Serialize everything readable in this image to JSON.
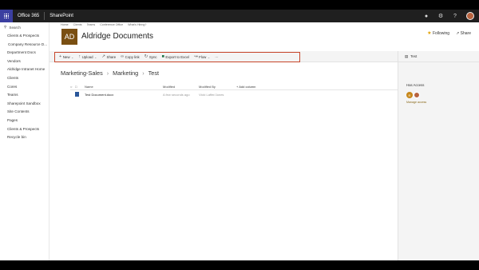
{
  "suitebar": {
    "brand": "Office 365",
    "app": "SharePoint",
    "icons": [
      "bell-icon",
      "gear-icon",
      "help-icon"
    ]
  },
  "leftnav": {
    "search_label": "Search",
    "items": [
      "Clients & Prospects",
      "Company Resource D...",
      "Department Docs",
      "Vendors",
      "Aldridge Intranet Home",
      "Clients",
      "Cores",
      "Teams",
      "Sharepoint Sandbox",
      "Site Contents",
      "Pages",
      "Clients & Prospects",
      "Recycle bin"
    ]
  },
  "header": {
    "top_links": [
      "Home",
      "Clients",
      "Teams",
      "Conference Office",
      "What's Hiring?"
    ],
    "logo_text": "AD",
    "title": "Aldridge Documents",
    "following": "Following",
    "share": "Share"
  },
  "commandbar": {
    "new": "New",
    "upload": "Upload",
    "share": "Share",
    "copy_link": "Copy link",
    "sync": "Sync",
    "export": "Export to Excel",
    "flow": "Flow",
    "more": "···",
    "view": "All Documents"
  },
  "path": [
    "Marketing-Sales",
    "Marketing",
    "Test"
  ],
  "table": {
    "columns": {
      "name": "Name",
      "modified": "Modified",
      "modified_by": "Modified By",
      "add_column": "+ Add column"
    },
    "rows": [
      {
        "name": "Test Document.docx",
        "modified": "A few seconds ago",
        "modified_by": "Vicki Laffer/Jones"
      }
    ]
  },
  "rightpanel": {
    "title": "Test",
    "has_access": "Has Access",
    "manage": "Manage access",
    "avatar_initial": "R"
  },
  "colors": {
    "suitebar": "#1f1f1f",
    "waffle": "#3b3fa0",
    "site_logo": "#7a4f12",
    "highlight_box": "#c7452a"
  }
}
